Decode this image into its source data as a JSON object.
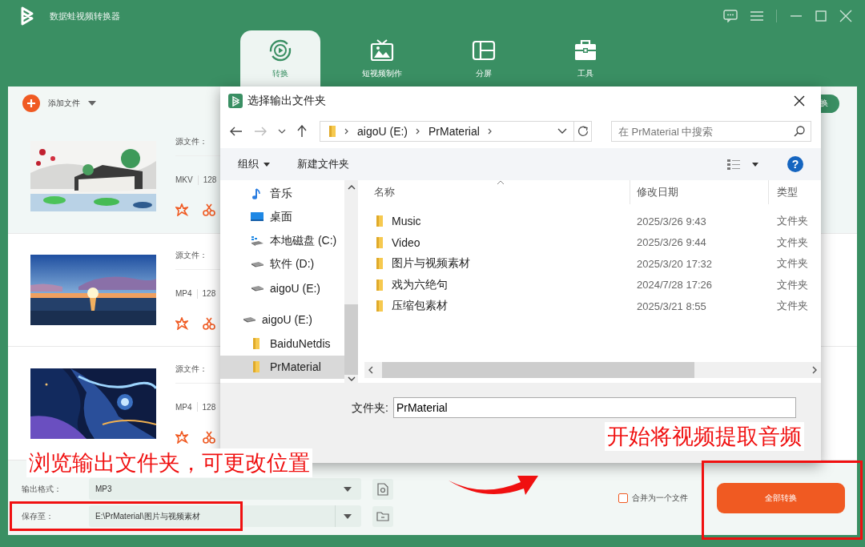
{
  "app": {
    "title": "数据蛙视频转换器"
  },
  "tabs": [
    {
      "label": "转换",
      "kind": "convert",
      "selected": true
    },
    {
      "label": "短视频制作",
      "kind": "video",
      "selected": false
    },
    {
      "label": "分屏",
      "kind": "split",
      "selected": false
    },
    {
      "label": "工具",
      "kind": "tools",
      "selected": false
    }
  ],
  "toolbar": {
    "add_file": "添加文件",
    "convert_button": "换"
  },
  "files": [
    {
      "source_label": "源文件：",
      "format": "MKV",
      "bitrate": "128",
      "selected": true
    },
    {
      "source_label": "源文件：",
      "format": "MP4",
      "bitrate": "128",
      "selected": false
    },
    {
      "source_label": "源文件：",
      "format": "MP4",
      "bitrate": "128",
      "selected": false
    }
  ],
  "output": {
    "format_label": "输出格式：",
    "format": "MP3",
    "save_label": "保存至：",
    "save_path": "E:\\PrMaterial\\图片与视频素材",
    "merge_label": "合并为一个文件",
    "merge_checked": false,
    "convert_all": "全部转换"
  },
  "dialog": {
    "title": "选择输出文件夹",
    "breadcrumb": [
      "aigoU (E:)",
      "PrMaterial"
    ],
    "search_placeholder": "在 PrMaterial 中搜索",
    "organize": "组织",
    "new_folder": "新建文件夹",
    "help": "?",
    "nav": [
      {
        "label": "音乐",
        "kind": "music",
        "selected": false
      },
      {
        "label": "桌面",
        "kind": "desktop",
        "selected": false
      },
      {
        "label": "本地磁盘 (C:)",
        "kind": "system",
        "selected": false
      },
      {
        "label": "软件 (D:)",
        "kind": "drive",
        "selected": false
      },
      {
        "label": "aigoU (E:)",
        "kind": "drive",
        "selected": false
      },
      {
        "label": "aigoU (E:)",
        "kind": "drive",
        "selected": false,
        "children": [
          {
            "label": "BaiduNetdis",
            "kind": "folder",
            "selected": false
          },
          {
            "label": "PrMaterial",
            "kind": "folder",
            "selected": true
          }
        ]
      }
    ],
    "columns": [
      "名称",
      "修改日期",
      "类型"
    ],
    "rows": [
      {
        "name": "Music",
        "date": "2025/3/26 9:43",
        "type": "文件夹"
      },
      {
        "name": "Video",
        "date": "2025/3/26 9:44",
        "type": "文件夹"
      },
      {
        "name": "图片与视频素材",
        "date": "2025/3/20 17:32",
        "type": "文件夹"
      },
      {
        "name": "戏为六绝句",
        "date": "2024/7/28 17:26",
        "type": "文件夹"
      },
      {
        "name": "压缩包素材",
        "date": "2025/3/21 8:55",
        "type": "文件夹"
      }
    ],
    "folder_label": "文件夹:",
    "folder_value": "PrMaterial"
  },
  "annotations": [
    {
      "text": "浏览输出文件夹，可更改位置"
    },
    {
      "text": "开始将视频提取音频"
    }
  ]
}
